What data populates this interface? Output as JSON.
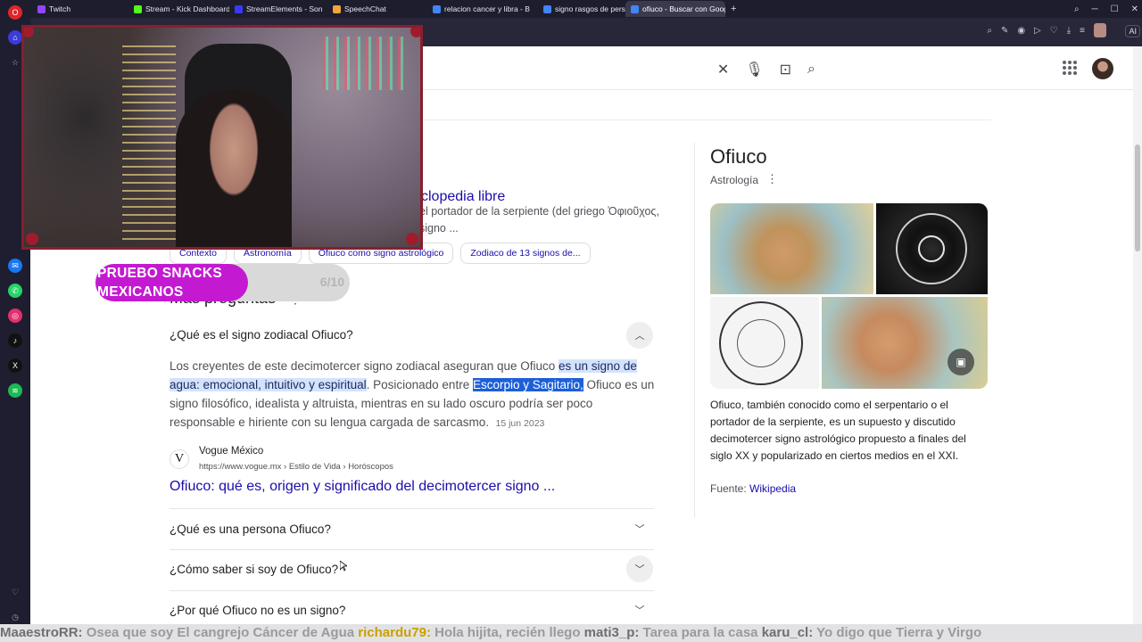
{
  "browser": {
    "tabs": [
      {
        "label": "Twitch",
        "color": "#9146ff",
        "active": false,
        "width": 108
      },
      {
        "label": "Stream - Kick Dashboard",
        "color": "#53fc18",
        "active": false,
        "width": 113
      },
      {
        "label": "StreamElements - Son",
        "color": "#3a3aff",
        "active": false,
        "width": 110
      },
      {
        "label": "SpeechChat",
        "color": "#f2a33a",
        "active": false,
        "width": 112
      },
      {
        "label": "relacion cancer y libra - B",
        "color": "#4285f4",
        "active": false,
        "width": 124
      },
      {
        "label": "signo rasgos de personali",
        "color": "#4285f4",
        "active": false,
        "width": 98
      },
      {
        "label": "ofiuco - Buscar con Goog",
        "color": "#4285f4",
        "active": true,
        "width": 112
      }
    ],
    "new_tab": "+",
    "ai_label": "AI"
  },
  "search": {
    "clear_icon": "close-icon",
    "mic_icon": "microphone-icon",
    "lens_icon": "camera-icon",
    "search_icon": "search-icon"
  },
  "result": {
    "title_fragment": "clopedia libre",
    "snippet": "el portador de la serpiente (del griego Ὀφιοῦχος, signo ..."
  },
  "chips": [
    "Contexto",
    "Astronomía",
    "Ofiuco como signo astrológico",
    "Zodiaco de 13 signos de..."
  ],
  "paa": {
    "title": "Más preguntas",
    "dots": "⋮",
    "questions": [
      "¿Qué es el signo zodiacal Ofiuco?",
      "¿Qué es una persona Ofiuco?",
      "¿Cómo saber si soy de Ofiuco?",
      "¿Por qué Ofiuco no es un signo?"
    ],
    "answer": {
      "part1": "Los creyentes de este decimotercer signo zodiacal aseguran que Ofiuco ",
      "highlight": "es un signo de agua: emocional, intuitivo y espiritual",
      "part2": ". Posicionado entre ",
      "selected": "Escorpio y Sagitario,",
      "part3": " Ofiuco es un signo filosófico, idealista y altruista, mientras en su lado oscuro podría ser poco responsable e hiriente con su lengua cargada de sarcasmo.",
      "date": "15 jun 2023"
    },
    "source": {
      "logo": "V",
      "name": "Vogue México",
      "url": "https://www.vogue.mx › Estilo de Vida › Horóscopos",
      "title": "Ofiuco: qué es, origen y significado del decimotercer signo ..."
    }
  },
  "knowledge_panel": {
    "title": "Ofiuco",
    "subtitle": "Astrología",
    "dots": "⋮",
    "description": "Ofiuco, también conocido como el serpentario o el portador de la serpiente, es un supuesto y discutido decimotercer signo astrológico propuesto a finales del siglo XX y popularizado en ciertos medios en el XXI.",
    "source_label": "Fuente: ",
    "source_link": "Wikipedia"
  },
  "overlay": {
    "goal_label": "PRUEBO SNACKS MEXICANOS",
    "goal_count": "6/10",
    "goal_progress": 0.6,
    "ticker": [
      {
        "user": "MaaestroRR:",
        "msg": " Osea que soy El cangrejo Cáncer de Agua "
      },
      {
        "user": "richardu79:",
        "msg": " Hola hijita, recién llego "
      },
      {
        "user": "mati3_p:",
        "msg": " Tarea para la casa "
      },
      {
        "user": "karu_cl:",
        "msg": " Yo digo que Tierra y Virgo"
      }
    ]
  }
}
